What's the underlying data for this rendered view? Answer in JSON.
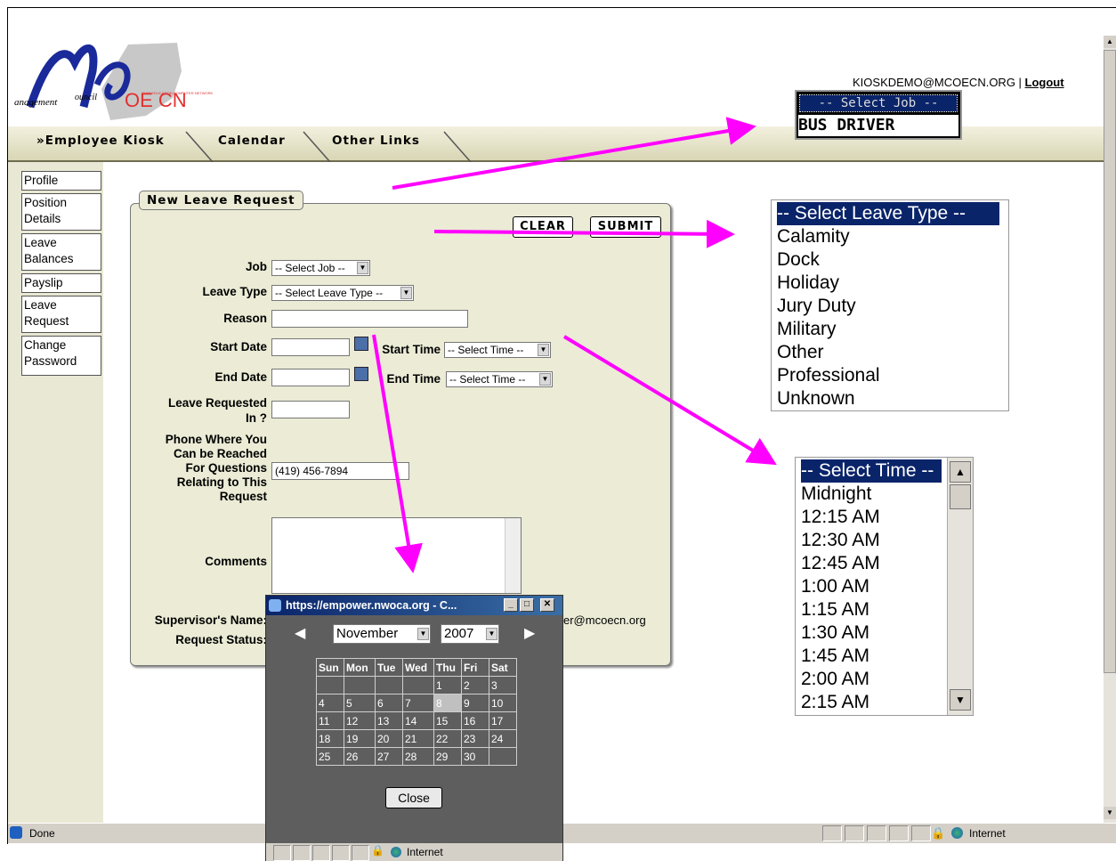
{
  "header": {
    "user_email": "KIOSKDEMO@MCOECN.ORG",
    "separator": " | ",
    "logout": "Logout",
    "logo_text_left": "anagement",
    "logo_text_mid": "ouncil",
    "logo_oecn": "OE CN",
    "logo_oecn_sub": "OHIO EDUCATION COMPUTER NETWORK"
  },
  "tabs": [
    {
      "label": "»Employee Kiosk"
    },
    {
      "label": "Calendar"
    },
    {
      "label": "Other Links"
    }
  ],
  "sidebar": {
    "items": [
      {
        "label": "Profile"
      },
      {
        "label": "Position Details"
      },
      {
        "label": "Leave Balances"
      },
      {
        "label": "Payslip"
      },
      {
        "label": "Leave Request"
      },
      {
        "label": "Change Password"
      }
    ]
  },
  "form": {
    "title": "New Leave Request",
    "clear_label": "CLEAR",
    "submit_label": "SUBMIT",
    "job_label": "Job",
    "job_value": "-- Select Job --",
    "leave_type_label": "Leave Type",
    "leave_type_value": "-- Select Leave Type --",
    "reason_label": "Reason",
    "reason_value": "",
    "start_date_label": "Start Date",
    "start_time_label": "Start Time",
    "start_time_value": "-- Select Time --",
    "end_date_label": "End Date",
    "end_time_label": "End Time",
    "end_time_value": "-- Select Time --",
    "leave_requested_in_label_1": "Leave Requested",
    "leave_requested_in_label_2": "In ?",
    "phone_label": [
      "Phone Where You",
      "Can be Reached",
      "For Questions",
      "Relating to This",
      "Request"
    ],
    "phone_value": "(419) 456-7894",
    "comments_label": "Comments",
    "supervisor_label": "Supervisor's Name:",
    "supervisor_value_tail": "er@mcoecn.org",
    "status_label": "Request Status:"
  },
  "calendar_popup": {
    "title": "https://empower.nwoca.org - C...",
    "month": "November",
    "year": "2007",
    "weekdays": [
      "Sun",
      "Mon",
      "Tue",
      "Wed",
      "Thu",
      "Fri",
      "Sat"
    ],
    "weeks": [
      [
        "",
        "",
        "",
        "",
        "1",
        "2",
        "3"
      ],
      [
        "4",
        "5",
        "6",
        "7",
        "8",
        "9",
        "10"
      ],
      [
        "11",
        "12",
        "13",
        "14",
        "15",
        "16",
        "17"
      ],
      [
        "18",
        "19",
        "20",
        "21",
        "22",
        "23",
        "24"
      ],
      [
        "25",
        "26",
        "27",
        "28",
        "29",
        "30",
        ""
      ]
    ],
    "today": "8",
    "close_label": "Close",
    "zone_label": "Internet"
  },
  "status_bar": {
    "text": "Done",
    "zone_label": "Internet"
  },
  "zoom_job": {
    "items": [
      "-- Select Job --",
      "BUS DRIVER"
    ]
  },
  "zoom_leave_type": {
    "items": [
      "-- Select Leave Type --",
      "Calamity",
      "Dock",
      "Holiday",
      "Jury Duty",
      "Military",
      "Other",
      "Professional",
      "Unknown"
    ]
  },
  "zoom_time": {
    "items": [
      "-- Select Time --",
      "Midnight",
      "12:15 AM",
      "12:30 AM",
      "12:45 AM",
      "1:00 AM",
      "1:15 AM",
      "1:30 AM",
      "1:45 AM",
      "2:00 AM",
      "2:15 AM"
    ]
  },
  "colors": {
    "arrow": "#ff00ff",
    "panel_bg": "#ebebd6",
    "selection": "#0a246a"
  }
}
